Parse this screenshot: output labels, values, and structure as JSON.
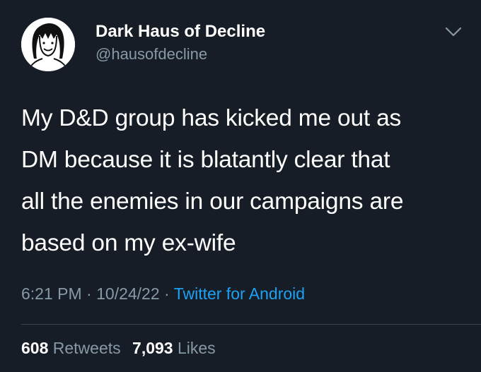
{
  "tweet": {
    "display_name": "Dark Haus of Decline",
    "handle": "@hausofdecline",
    "body_lines": [
      "My D&D group has kicked me out as",
      "DM because it is blatantly clear that",
      "all the enemies in our campaigns are",
      "based on my ex-wife"
    ],
    "time": "6:21 PM",
    "date": "10/24/22",
    "separator": "·",
    "source": "Twitter for Android",
    "retweets_count": "608",
    "retweets_label": "Retweets",
    "likes_count": "7,093",
    "likes_label": "Likes",
    "menu_icon": "chevron-down-icon",
    "avatar_icon": "cartoon-face-avatar"
  },
  "colors": {
    "background": "#161d26",
    "secondary_text": "#8899a6",
    "link": "#1da1f2",
    "divider": "#38444d"
  }
}
